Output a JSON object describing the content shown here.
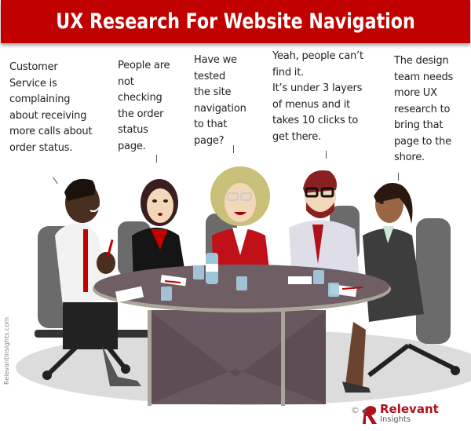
{
  "banner": {
    "title": "UX Research For Website Navigation",
    "color": "#c10000"
  },
  "captions": [
    {
      "speaker": "man-white-shirt-left",
      "text": "Customer\nService is\ncomplaining\nabout receiving\nmore calls about\norder status."
    },
    {
      "speaker": "woman-black-jacket",
      "text": "People are\nnot\nchecking\nthe order\nstatus\npage."
    },
    {
      "speaker": "woman-curly-hair",
      "text": "Have we\ntested\nthe site\nnavigation\nto that\npage?"
    },
    {
      "speaker": "man-beard-glasses",
      "text": "Yeah, people can’t\nfind it.\nIt’s under 3 layers\nof menus and it\ntakes 10 clicks to\nget there."
    },
    {
      "speaker": "woman-ponytail",
      "text": "The design\nteam needs\nmore UX\nresearch to\nbring that\npage to the\nshore."
    }
  ],
  "credit": {
    "side_text": "RelevantInsights.com",
    "copyright_symbol": "©",
    "logo_word1": "Relevant",
    "logo_word2": "Insights",
    "logo_icon": "relevant-insights-r-logo"
  },
  "palette": {
    "accent_red": "#c10000",
    "table": "#6f5e64",
    "chair": "#6b6b6b",
    "floor": "#dcdcdc"
  }
}
